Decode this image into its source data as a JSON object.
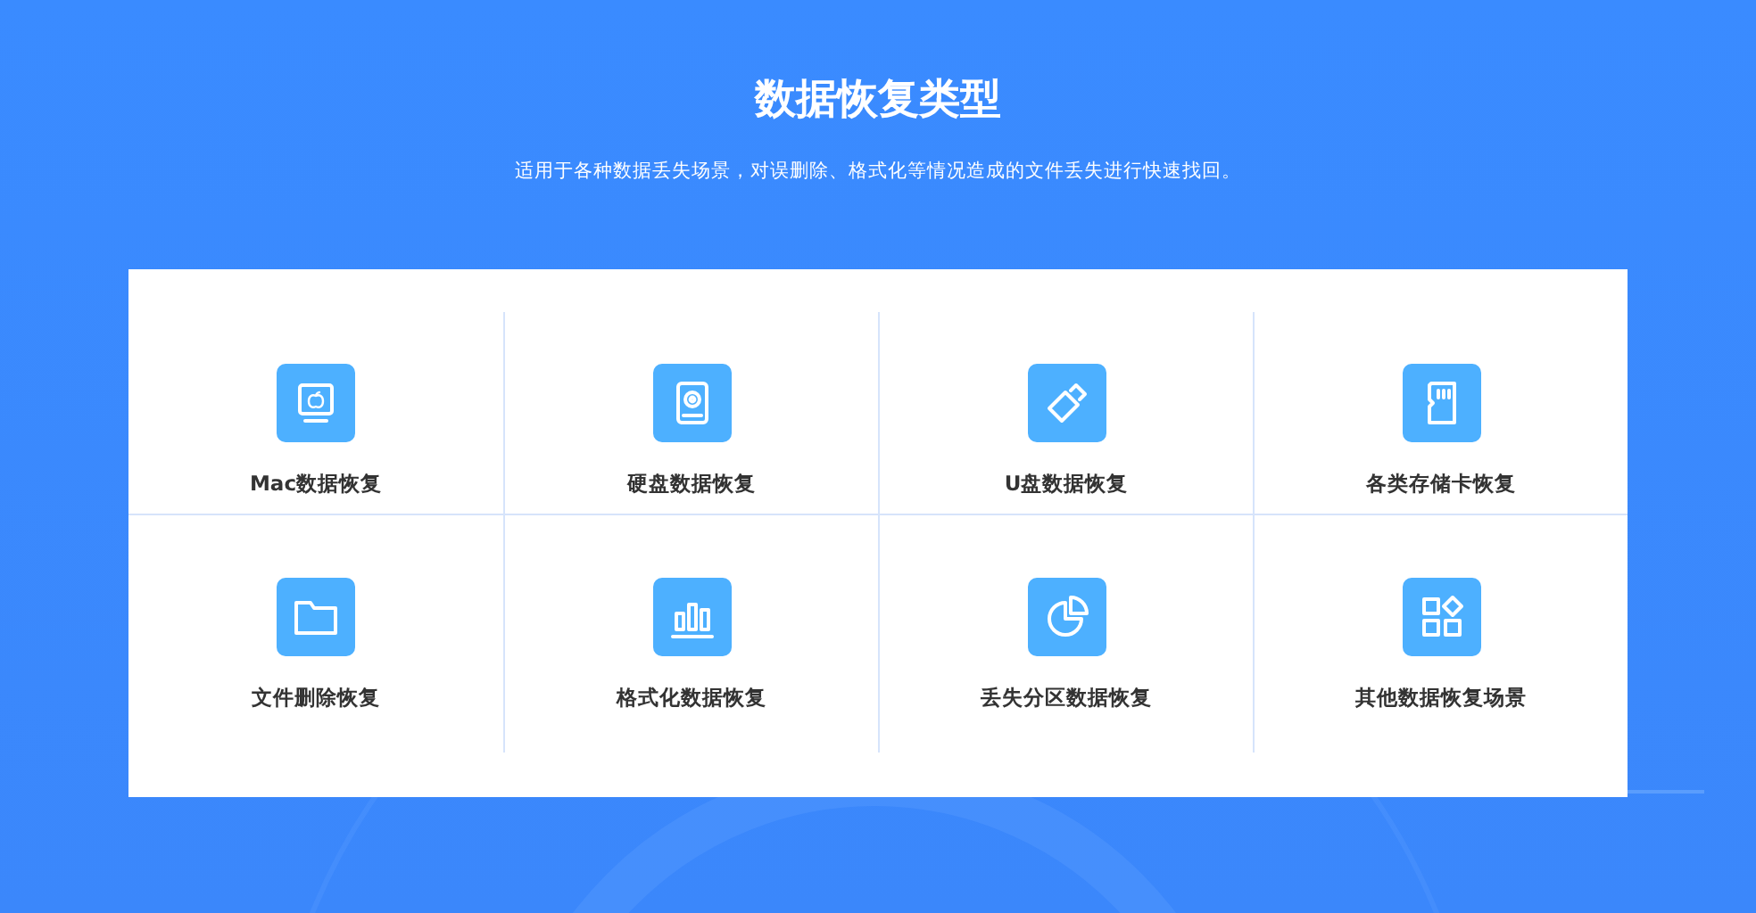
{
  "heading": {
    "title": "数据恢复类型",
    "subtitle": "适用于各种数据丢失场景，对误删除、格式化等情况造成的文件丢失进行快速找回。"
  },
  "types": [
    {
      "label": "Mac数据恢复"
    },
    {
      "label": "硬盘数据恢复"
    },
    {
      "label": "U盘数据恢复"
    },
    {
      "label": "各类存储卡恢复"
    },
    {
      "label": "文件删除恢复"
    },
    {
      "label": "格式化数据恢复"
    },
    {
      "label": "丢失分区数据恢复"
    },
    {
      "label": "其他数据恢复场景"
    }
  ]
}
